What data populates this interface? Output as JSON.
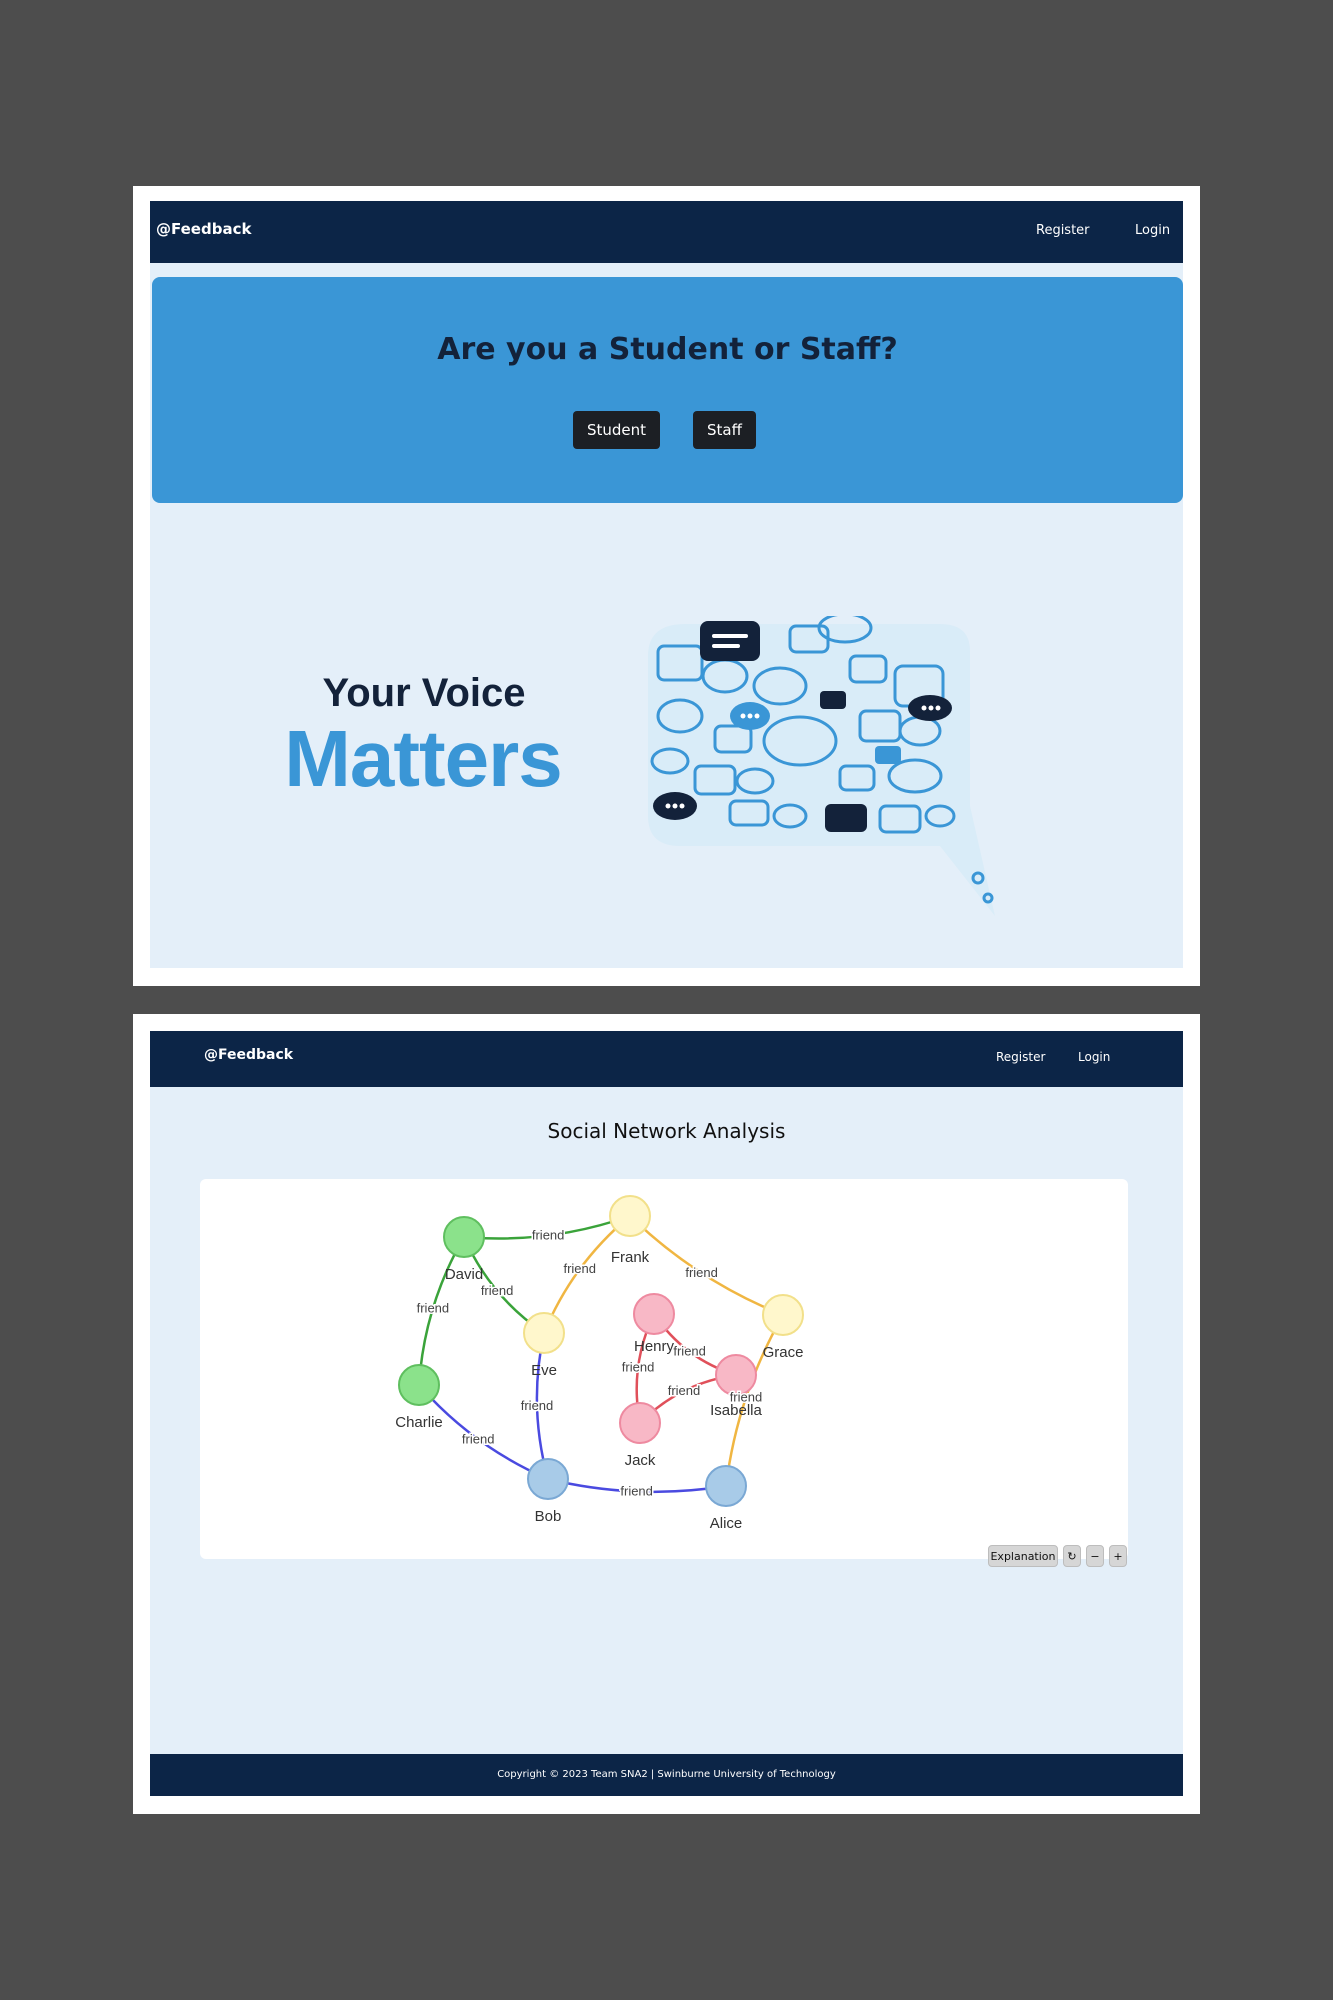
{
  "landing": {
    "brand": "@Feedback",
    "nav": {
      "register": "Register",
      "login": "Login"
    },
    "hero": {
      "title": "Are you a Student or Staff?",
      "student_button": "Student",
      "staff_button": "Staff"
    },
    "tagline": {
      "line1": "Your Voice",
      "line2": "Matters"
    }
  },
  "analysis": {
    "brand": "@Feedback",
    "nav": {
      "register": "Register",
      "login": "Login"
    },
    "title": "Social Network Analysis",
    "controls": {
      "explanation": "Explanation",
      "refresh_icon": "refresh-icon",
      "zoom_out_icon": "minus-icon",
      "zoom_in_icon": "plus-icon"
    },
    "footer": "Copyright © 2023 Team SNA2 | Swinburne University of Technology",
    "graph": {
      "nodes": [
        {
          "id": "David",
          "color": "#8be28b",
          "stroke": "#5fbf5f"
        },
        {
          "id": "Frank",
          "color": "#fff7cc",
          "stroke": "#f2e08a"
        },
        {
          "id": "Eve",
          "color": "#fff7cc",
          "stroke": "#f2e08a"
        },
        {
          "id": "Grace",
          "color": "#fff7cc",
          "stroke": "#f2e08a"
        },
        {
          "id": "Charlie",
          "color": "#8be28b",
          "stroke": "#5fbf5f"
        },
        {
          "id": "Henry",
          "color": "#f8b8c6",
          "stroke": "#ee8aa0"
        },
        {
          "id": "Isabella",
          "color": "#f8b8c6",
          "stroke": "#ee8aa0"
        },
        {
          "id": "Jack",
          "color": "#f8b8c6",
          "stroke": "#ee8aa0"
        },
        {
          "id": "Bob",
          "color": "#a8cbe8",
          "stroke": "#7aa8d4"
        },
        {
          "id": "Alice",
          "color": "#a8cbe8",
          "stroke": "#7aa8d4"
        }
      ],
      "edges": [
        {
          "source": "David",
          "target": "Frank",
          "label": "friend",
          "color": "#3aa33a"
        },
        {
          "source": "David",
          "target": "Eve",
          "label": "friend",
          "color": "#3aa33a"
        },
        {
          "source": "David",
          "target": "Charlie",
          "label": "friend",
          "color": "#3aa33a"
        },
        {
          "source": "Frank",
          "target": "Eve",
          "label": "friend",
          "color": "#f0b642"
        },
        {
          "source": "Frank",
          "target": "Grace",
          "label": "friend",
          "color": "#f0b642"
        },
        {
          "source": "Grace",
          "target": "Alice",
          "label": "friend",
          "color": "#f0b642"
        },
        {
          "source": "Henry",
          "target": "Isabella",
          "label": "friend",
          "color": "#e0505a"
        },
        {
          "source": "Henry",
          "target": "Jack",
          "label": "friend",
          "color": "#e0505a"
        },
        {
          "source": "Isabella",
          "target": "Jack",
          "label": "friend",
          "color": "#e0505a"
        },
        {
          "source": "Eve",
          "target": "Bob",
          "label": "friend",
          "color": "#4a4ae0"
        },
        {
          "source": "Charlie",
          "target": "Bob",
          "label": "friend",
          "color": "#4a4ae0"
        },
        {
          "source": "Bob",
          "target": "Alice",
          "label": "friend",
          "color": "#4a4ae0"
        }
      ]
    }
  }
}
